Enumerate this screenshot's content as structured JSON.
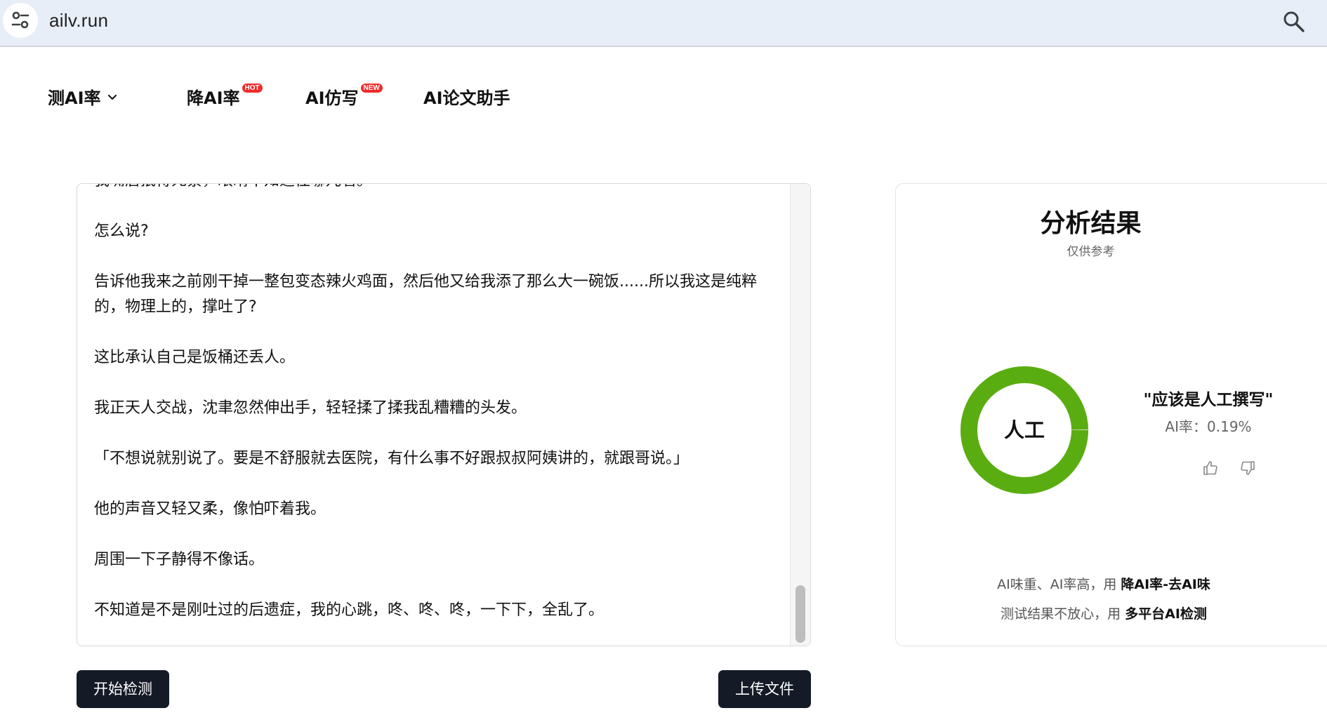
{
  "browser": {
    "url": "ailv.run"
  },
  "nav": {
    "items": [
      {
        "label": "测AI率",
        "has_dropdown": true
      },
      {
        "label": "降AI率",
        "badge": "HOT"
      },
      {
        "label": "AI仿写",
        "badge": "NEW"
      },
      {
        "label": "AI论文助手"
      }
    ]
  },
  "editor": {
    "paragraphs": [
      "我嘴唇抿得死紧，眼睛不知道往哪儿看。",
      "怎么说?",
      "告诉他我来之前刚干掉一整包变态辣火鸡面，然后他又给我添了那么大一碗饭......所以我这是纯粹的，物理上的，撑吐了?",
      "这比承认自己是饭桶还丢人。",
      "我正天人交战，沈聿忽然伸出手，轻轻揉了揉我乱糟糟的头发。",
      "「不想说就别说了。要是不舒服就去医院，有什么事不好跟叔叔阿姨讲的，就跟哥说。」",
      "他的声音又轻又柔，像怕吓着我。",
      "周围一下子静得不像话。",
      "不知道是不是刚吐过的后遗症，我的心跳，咚、咚、咚，一下下，全乱了。"
    ],
    "scroll_position": 0.92
  },
  "actions": {
    "start_label": "开始检测",
    "upload_label": "上传文件"
  },
  "result": {
    "title": "分析结果",
    "subtitle": "仅供参考",
    "donut_label": "人工",
    "human_fraction": 0.9981,
    "verdict": "\"应该是人工撰写\"",
    "ai_rate_label": "AI率：",
    "ai_rate_value": "0.19%",
    "tip1_prefix": "AI味重、AI率高，用",
    "tip1_link": "降AI率-去AI味",
    "tip2_prefix": "测试结果不放心，用",
    "tip2_link": "多平台AI检测"
  },
  "colors": {
    "human_ring": "#5aad10",
    "button_bg": "#141b27",
    "badge_red": "#ef2b2b"
  },
  "icons": [
    "site-info-icon",
    "search-icon",
    "chevron-down-icon",
    "thumb-up-icon",
    "thumb-down-icon"
  ]
}
